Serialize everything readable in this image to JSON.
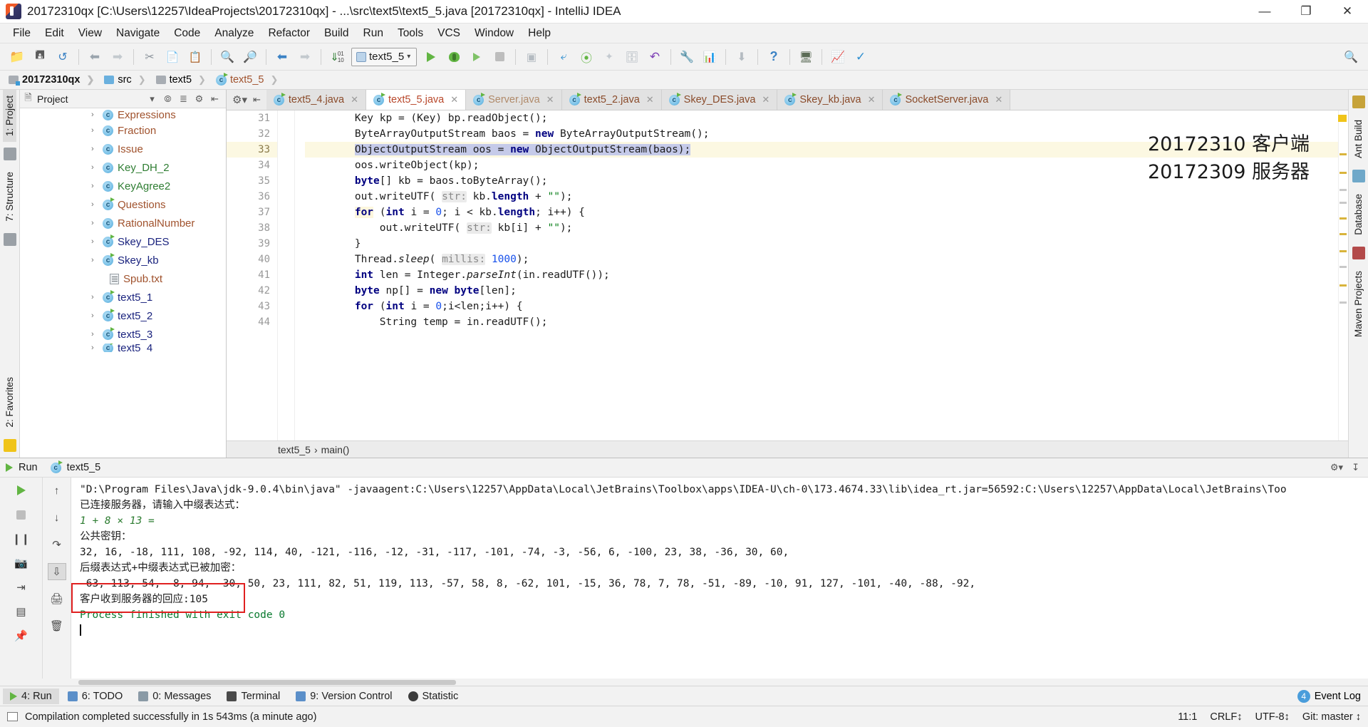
{
  "window": {
    "title": "20172310qx [C:\\Users\\12257\\IdeaProjects\\20172310qx] - ...\\src\\text5\\text5_5.java [20172310qx] - IntelliJ IDEA",
    "minimize": "—",
    "maximize": "❐",
    "close": "✕"
  },
  "menu": {
    "items": [
      "File",
      "Edit",
      "View",
      "Navigate",
      "Code",
      "Analyze",
      "Refactor",
      "Build",
      "Run",
      "Tools",
      "VCS",
      "Window",
      "Help"
    ]
  },
  "toolbar": {
    "open_label": "open-folder",
    "save_label": "save-all",
    "sync_label": "synchronize",
    "back_label": "back",
    "forward_label": "forward",
    "cut_label": "cut",
    "copy_label": "copy",
    "paste_label": "paste",
    "find_label": "find",
    "replace_label": "replace",
    "nav_back_label": "navigate-back",
    "nav_fwd_label": "navigate-forward",
    "compile_label": "compile",
    "run_config_name": "text5_5",
    "run_label": "Run",
    "debug_label": "Debug",
    "coverage_label": "Run with Coverage",
    "stop_label": "Stop",
    "profile_label": "Profile",
    "update_project_label": "Update Project",
    "commit_label": "Commit",
    "diff_label": "Compare",
    "vcs_ops_label": "VCS Operations",
    "revert_label": "Revert",
    "settings_label": "Settings",
    "project_structure_label": "Project Structure",
    "download_label": "Download",
    "help_label": "?",
    "sdk_label": "SDK",
    "monitor_label": "Monitor",
    "check_label": "Check"
  },
  "navbar": {
    "crumbs": [
      {
        "label": "20172310qx",
        "icon": "module-icon",
        "bold": true
      },
      {
        "label": "src",
        "icon": "folder-icon",
        "bold": false
      },
      {
        "label": "text5",
        "icon": "folder-grey-icon",
        "bold": false
      },
      {
        "label": "text5_5",
        "icon": "java-class-icon",
        "bold": false
      }
    ]
  },
  "left_strip": {
    "tabs": [
      "1: Project",
      "7: Structure",
      "2: Favorites"
    ]
  },
  "right_strip": {
    "tabs": [
      "Ant Build",
      "Database",
      "Maven Projects"
    ]
  },
  "project_panel": {
    "title": "Project",
    "tree": [
      {
        "label": "Expressions",
        "arrow": "›",
        "icon": "java-class-icon",
        "color": "orange",
        "partial": true
      },
      {
        "label": "Fraction",
        "arrow": "›",
        "icon": "java-class-icon",
        "color": "orange"
      },
      {
        "label": "Issue",
        "arrow": "›",
        "icon": "java-class-icon",
        "color": "orange"
      },
      {
        "label": "Key_DH_2",
        "arrow": "›",
        "icon": "java-class-icon",
        "color": "green"
      },
      {
        "label": "KeyAgree2",
        "arrow": "›",
        "icon": "java-class-icon",
        "color": "green"
      },
      {
        "label": "Questions",
        "arrow": "›",
        "icon": "java-class-runnable-icon",
        "color": "orange"
      },
      {
        "label": "RationalNumber",
        "arrow": "›",
        "icon": "java-class-icon",
        "color": "orange"
      },
      {
        "label": "Skey_DES",
        "arrow": "›",
        "icon": "java-class-runnable-icon",
        "color": "blue"
      },
      {
        "label": "Skey_kb",
        "arrow": "›",
        "icon": "java-class-runnable-icon",
        "color": "blue"
      },
      {
        "label": "Spub.txt",
        "arrow": "",
        "icon": "text-file-icon",
        "color": "orange"
      },
      {
        "label": "text5_1",
        "arrow": "›",
        "icon": "java-class-runnable-icon",
        "color": "blue"
      },
      {
        "label": "text5_2",
        "arrow": "›",
        "icon": "java-class-runnable-icon",
        "color": "blue"
      },
      {
        "label": "text5_3",
        "arrow": "›",
        "icon": "java-class-runnable-icon",
        "color": "blue"
      },
      {
        "label": "text5_4",
        "arrow": "›",
        "icon": "java-class-runnable-icon",
        "color": "blue"
      }
    ]
  },
  "editor": {
    "tabs": [
      {
        "label": "text5_4.java",
        "active": false,
        "muted": false
      },
      {
        "label": "text5_5.java",
        "active": true,
        "muted": false
      },
      {
        "label": "Server.java",
        "active": false,
        "muted": true
      },
      {
        "label": "text5_2.java",
        "active": false,
        "muted": false
      },
      {
        "label": "Skey_DES.java",
        "active": false,
        "muted": false
      },
      {
        "label": "Skey_kb.java",
        "active": false,
        "muted": false
      },
      {
        "label": "SocketServer.java",
        "active": false,
        "muted": false
      }
    ],
    "close_glyph": "✕",
    "first_line_number": 31,
    "lines": [
      {
        "n": 31,
        "highlight": false,
        "text": "        Key kp = (Key) bp.readObject();"
      },
      {
        "n": 32,
        "highlight": false,
        "text": "        ByteArrayOutputStream baos = new ByteArrayOutputStream();"
      },
      {
        "n": 33,
        "highlight": true,
        "text": "        ObjectOutputStream oos = new ObjectOutputStream(baos);"
      },
      {
        "n": 34,
        "highlight": false,
        "text": "        oos.writeObject(kp);"
      },
      {
        "n": 35,
        "highlight": false,
        "text": "        byte[] kb = baos.toByteArray();"
      },
      {
        "n": 36,
        "highlight": false,
        "text": "        out.writeUTF( str: kb.length + \"\");"
      },
      {
        "n": 37,
        "highlight": false,
        "text": "        for (int i = 0; i < kb.length; i++) {"
      },
      {
        "n": 38,
        "highlight": false,
        "text": "            out.writeUTF( str: kb[i] + \"\");"
      },
      {
        "n": 39,
        "highlight": false,
        "text": "        }"
      },
      {
        "n": 40,
        "highlight": false,
        "text": "        Thread.sleep( millis: 1000);"
      },
      {
        "n": 41,
        "highlight": false,
        "text": "        int len = Integer.parseInt(in.readUTF());"
      },
      {
        "n": 42,
        "highlight": false,
        "text": "        byte np[] = new byte[len];"
      },
      {
        "n": 43,
        "highlight": false,
        "text": "        for (int i = 0;i<len;i++) {"
      },
      {
        "n": 44,
        "highlight": false,
        "text": "            String temp = in.readUTF();"
      }
    ],
    "overlay_note_line1": "20172310 客户端",
    "overlay_note_line2": "20172309 服务器",
    "breadcrumb": [
      "text5_5",
      "main()"
    ],
    "breadcrumb_sep": "›"
  },
  "run_window": {
    "title": "Run",
    "config_name": "text5_5",
    "settings_label": "settings",
    "hide_label": "hide",
    "buttons": [
      "rerun",
      "stop",
      "pause",
      "resume",
      "camera",
      "print",
      "wrap",
      "scroll-to-end",
      "soft-wrap",
      "clear-all",
      "trash"
    ],
    "console": [
      {
        "style": "sys",
        "text": "\"D:\\Program Files\\Java\\jdk-9.0.4\\bin\\java\" -javaagent:C:\\Users\\12257\\AppData\\Local\\JetBrains\\Toolbox\\apps\\IDEA-U\\ch-0\\173.4674.33\\lib\\idea_rt.jar=56592:C:\\Users\\12257\\AppData\\Local\\JetBrains\\Too"
      },
      {
        "style": "sys",
        "text": "已连接服务器，请输入中缀表达式："
      },
      {
        "style": "green",
        "text": "1 + 8 × 13 ="
      },
      {
        "style": "sys",
        "text": "公共密钥："
      },
      {
        "style": "sys",
        "text": "32, 16, -18, 111, 108, -92, 114, 40, -121, -116, -12, -31, -117, -101, -74, -3, -56, 6, -100, 23, 38, -36, 30, 60,"
      },
      {
        "style": "sys",
        "text": "后缀表达式+中缀表达式已被加密："
      },
      {
        "style": "sys",
        "text": "-63, 113, 54, -8, 94, -30, 50, 23, 111, 82, 51, 119, 113, -57, 58, 8, -62, 101, -15, 36, 78, 7, 78, -51, -89, -10, 91, 127, -101, -40, -88, -92,"
      },
      {
        "style": "sys",
        "text": "客户收到服务器的回应:105"
      },
      {
        "style": "green",
        "text": "Process finished with exit code 0"
      }
    ],
    "highlight_box_color": "#e02020",
    "highlight_box_line_index": 7
  },
  "tool_window_bar": {
    "items": [
      {
        "label": "4: Run",
        "icon": "run-icon",
        "active": true
      },
      {
        "label": "6: TODO",
        "icon": "todo-icon",
        "active": false
      },
      {
        "label": "0: Messages",
        "icon": "messages-icon",
        "active": false
      },
      {
        "label": "Terminal",
        "icon": "terminal-icon",
        "active": false
      },
      {
        "label": "9: Version Control",
        "icon": "vcs-icon",
        "active": false
      },
      {
        "label": "Statistic",
        "icon": "statistic-icon",
        "active": false
      }
    ],
    "event_log": "Event Log",
    "event_count": "4"
  },
  "statusbar": {
    "message": "Compilation completed successfully in 1s 543ms (a minute ago)",
    "caret_position": "11:1",
    "line_separator": "CRLF↕",
    "encoding": "UTF-8↕",
    "branch": "Git: master ↕"
  },
  "colors": {
    "accent_green": "#62b543",
    "keyword_blue": "#000080",
    "string_green": "#067d17",
    "number_blue": "#1750eb",
    "tab_active_bg": "#ffffff",
    "highlight_line": "#fcf8e2",
    "error_box": "#e02020"
  }
}
